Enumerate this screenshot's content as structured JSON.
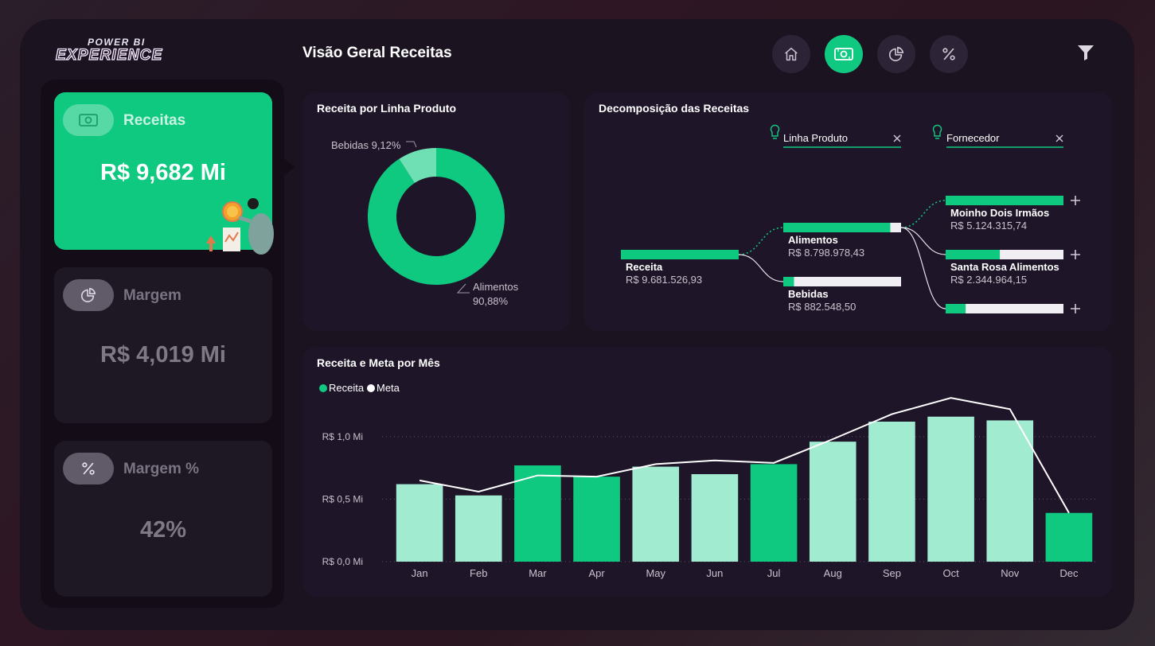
{
  "header": {
    "logo_line1": "POWER BI",
    "logo_line2": "EXPERIENCE",
    "title": "Visão Geral Receitas",
    "nav": [
      {
        "icon": "home-icon",
        "active": false
      },
      {
        "icon": "money-icon",
        "active": true
      },
      {
        "icon": "pie-chart-icon",
        "active": false
      },
      {
        "icon": "percent-icon",
        "active": false
      }
    ],
    "filter_icon": "filter-icon"
  },
  "kpis": [
    {
      "label": "Receitas",
      "value": "R$ 9,682 Mi",
      "icon": "money-icon",
      "active": true
    },
    {
      "label": "Margem",
      "value": "R$ 4,019 Mi",
      "icon": "pie-chart-icon",
      "active": false
    },
    {
      "label": "Margem %",
      "value": "42%",
      "icon": "percent-icon",
      "active": false
    }
  ],
  "donut": {
    "title": "Receita por Linha Produto",
    "label_bebidas": "Bebidas 9,12%",
    "label_alimentos_1": "Alimentos",
    "label_alimentos_2": "90,88%",
    "chart_data": {
      "type": "pie",
      "title": "Receita por Linha Produto",
      "categories": [
        "Alimentos",
        "Bebidas"
      ],
      "values": [
        90.88,
        9.12
      ],
      "colors": [
        "#10c981",
        "#6fe0b4"
      ]
    }
  },
  "decomp": {
    "title": "Decomposição das Receitas",
    "filters": [
      {
        "label": "Linha Produto"
      },
      {
        "label": "Fornecedor"
      }
    ],
    "root": {
      "name": "Receita",
      "value": "R$ 9.681.526,93",
      "fill": 1.0
    },
    "level1": [
      {
        "name": "Alimentos",
        "value": "R$ 8.798.978,43",
        "fill": 0.9088
      },
      {
        "name": "Bebidas",
        "value": "R$ 882.548,50",
        "fill": 0.0912
      }
    ],
    "level2": [
      {
        "name": "Moinho Dois Irmãos",
        "value": "R$ 5.124.315,74",
        "fill": 1.0
      },
      {
        "name": "Santa Rosa Alimentos",
        "value": "R$ 2.344.964,15",
        "fill": 0.46
      },
      {
        "name": "",
        "value": "",
        "fill": 0.17
      }
    ]
  },
  "monthly": {
    "title": "Receita e Meta por Mês",
    "legend": [
      {
        "name": "Receita",
        "color": "#10c981"
      },
      {
        "name": "Meta",
        "color": "#ffffff"
      }
    ],
    "chart_data": {
      "type": "bar",
      "title": "Receita e Meta por Mês",
      "categories": [
        "Jan",
        "Feb",
        "Mar",
        "Apr",
        "May",
        "Jun",
        "Jul",
        "Aug",
        "Sep",
        "Oct",
        "Nov",
        "Dec"
      ],
      "y_ticks": [
        "R$ 0,0 Mi",
        "R$ 0,5 Mi",
        "R$ 1,0 Mi"
      ],
      "ylim": [
        0,
        1.4
      ],
      "grid": true,
      "legend_position": "top-left",
      "series": [
        {
          "name": "Receita",
          "type": "bar",
          "values": [
            0.62,
            0.53,
            0.77,
            0.68,
            0.76,
            0.7,
            0.78,
            0.96,
            1.12,
            1.16,
            1.13,
            0.39
          ],
          "highlight": [
            false,
            false,
            true,
            true,
            false,
            false,
            true,
            false,
            false,
            false,
            false,
            true
          ]
        },
        {
          "name": "Meta",
          "type": "line",
          "values": [
            0.65,
            0.56,
            0.69,
            0.68,
            0.78,
            0.81,
            0.79,
            0.98,
            1.18,
            1.31,
            1.22,
            0.39
          ]
        }
      ],
      "colors": {
        "highlight": "#10c981",
        "normal": "#a1ebd0",
        "line": "#ffffff"
      }
    }
  }
}
